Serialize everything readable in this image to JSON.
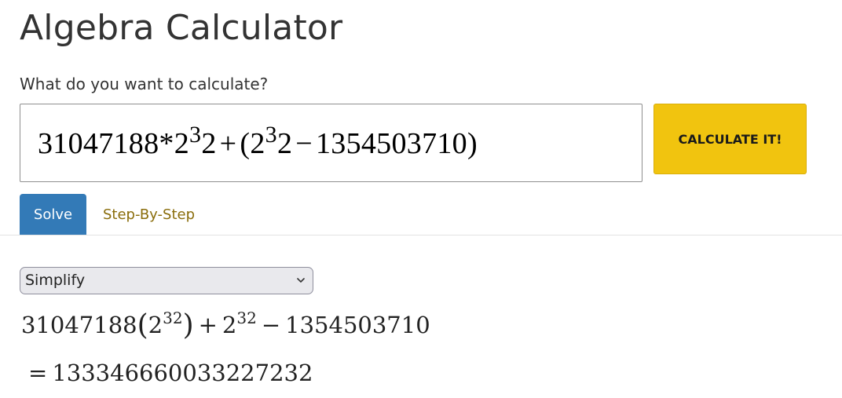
{
  "title": "Algebra Calculator",
  "prompt": "What do you want to calculate?",
  "input": {
    "expression_parts": {
      "a": "31047188*2",
      "sup1": "3",
      "b": "2",
      "plus": "+",
      "open": "(2",
      "sup2": "3",
      "c": "2",
      "minus": "−",
      "d": "1354503710)"
    }
  },
  "calculate_button": {
    "label": "CALCULATE IT!"
  },
  "tabs": [
    {
      "label": "Solve",
      "active": true
    },
    {
      "label": "Step-By-Step",
      "active": false
    }
  ],
  "mode_select": {
    "selected": "Simplify"
  },
  "result": {
    "line1": {
      "coef": "31047188",
      "lparen": "(",
      "base1": "2",
      "exp1": "32",
      "rparen": ")",
      "plus": "+",
      "base2": "2",
      "exp2": "32",
      "minus": "−",
      "const": "1354503710"
    },
    "line2": {
      "eq": "=",
      "value": "133346660033227232"
    }
  },
  "colors": {
    "accent_button": "#f1c40f",
    "active_tab": "#337ab7",
    "link_tab": "#8a6d0b"
  },
  "icons": {
    "select_arrow": "chevron-down-icon"
  }
}
